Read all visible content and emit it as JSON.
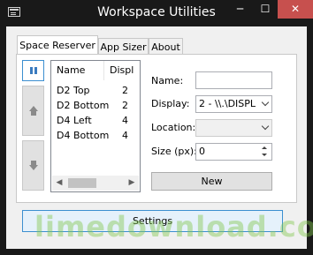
{
  "window": {
    "title": "Workspace Utilities",
    "minimize_glyph": "─",
    "maximize_glyph": "☐",
    "close_glyph": "✕",
    "close_color": "#c7504e"
  },
  "tabs": [
    {
      "label": "Space Reserver",
      "active": true
    },
    {
      "label": "App Sizer",
      "active": false
    },
    {
      "label": "About",
      "active": false
    }
  ],
  "side_buttons": {
    "pause_icon": "pause-icon",
    "up_icon": "arrow-up-icon",
    "down_icon": "arrow-down-icon"
  },
  "list": {
    "columns": [
      "Name",
      "Displ"
    ],
    "rows": [
      {
        "name": "D2 Top",
        "display": "2"
      },
      {
        "name": "D2 Bottom",
        "display": "2"
      },
      {
        "name": "D4 Left",
        "display": "4"
      },
      {
        "name": "D4 Bottom",
        "display": "4"
      }
    ],
    "scroll_left": "◀",
    "scroll_right": "▶"
  },
  "form": {
    "name_label": "Name:",
    "name_value": "",
    "display_label": "Display:",
    "display_value": "2 - \\\\.\\DISPL",
    "location_label": "Location:",
    "location_value": "",
    "size_label": "Size (px):",
    "size_value": "0",
    "new_button": "New"
  },
  "settings_button": "Settings",
  "watermark": "limedownload.com"
}
